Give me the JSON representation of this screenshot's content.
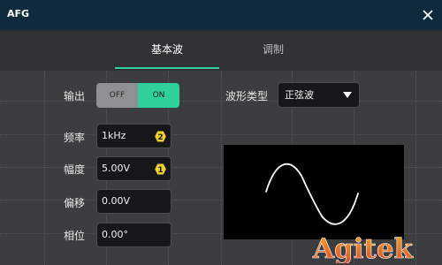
{
  "window": {
    "title": "AFG"
  },
  "tabs": [
    {
      "label": "基本波",
      "active": true
    },
    {
      "label": "调制",
      "active": false
    }
  ],
  "output": {
    "label": "输出",
    "off_label": "OFF",
    "on_label": "ON",
    "state": "ON"
  },
  "frequency": {
    "label": "频率",
    "value": "1kHz",
    "badge": "2"
  },
  "amplitude": {
    "label": "幅度",
    "value": "5.00V",
    "badge": "1"
  },
  "offset": {
    "label": "偏移",
    "value": "0.00V"
  },
  "phase": {
    "label": "相位",
    "value": "0.00°"
  },
  "waveform": {
    "label": "波形类型",
    "selected": "正弦波",
    "preview_icon": "sine-wave"
  },
  "watermark": {
    "text": "Agitek"
  },
  "colors": {
    "accent": "#2fd09a",
    "titlebar": "#0f2a3d",
    "badge": "#f0d02a",
    "panel": "#3c3d3f"
  }
}
